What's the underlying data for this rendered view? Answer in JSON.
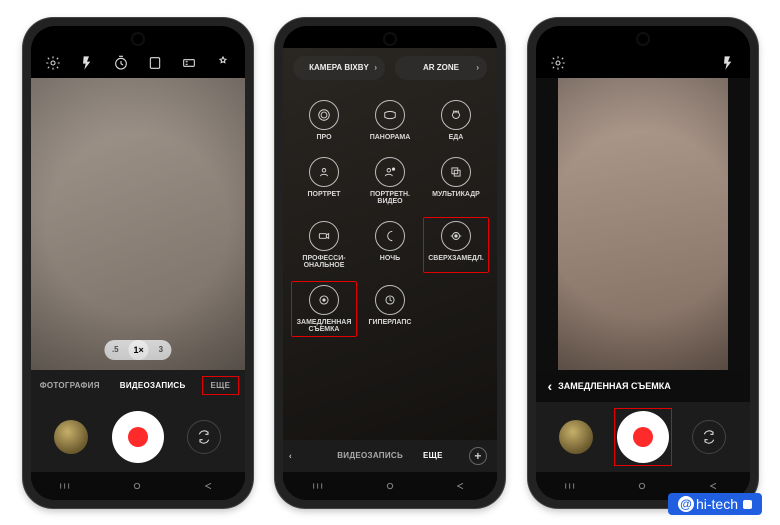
{
  "phone1": {
    "top_icons": [
      "settings",
      "flash",
      "timer",
      "ratio",
      "resolution",
      "filters"
    ],
    "zoom": {
      "levels": [
        ".5",
        "1×",
        "3"
      ],
      "active_index": 1
    },
    "modes": [
      {
        "label": "ФОТОГРАФИЯ",
        "active": false,
        "highlight": false
      },
      {
        "label": "ВИДЕОЗАПИСЬ",
        "active": true,
        "highlight": false
      },
      {
        "label": "ЕЩЕ",
        "active": false,
        "highlight": true
      }
    ],
    "shutter": {
      "type": "video"
    }
  },
  "phone2": {
    "top_pills": [
      {
        "label": "КАМЕРА BIXBY"
      },
      {
        "label": "AR ZONE"
      }
    ],
    "grid": [
      {
        "icon": "pro",
        "label": "ПРО"
      },
      {
        "icon": "panorama",
        "label": "ПАНОРАМА"
      },
      {
        "icon": "food",
        "label": "ЕДА"
      },
      {
        "icon": "portrait",
        "label": "ПОРТРЕТ"
      },
      {
        "icon": "portrait-v",
        "label": "ПОРТРЕТН. ВИДЕО"
      },
      {
        "icon": "multi",
        "label": "МУЛЬТИКАДР"
      },
      {
        "icon": "prof",
        "label": "ПРОФЕССИ-\nОНАЛЬНОЕ"
      },
      {
        "icon": "night",
        "label": "НОЧЬ"
      },
      {
        "icon": "superslow",
        "label": "СВЕРХЗАМЕДЛ.",
        "highlight": true
      },
      {
        "icon": "slowmo",
        "label": "ЗАМЕДЛЕННАЯ СЪЕМКА",
        "highlight": true
      },
      {
        "icon": "hyperlapse",
        "label": "ГИПЕРЛАПС"
      }
    ],
    "modes": {
      "back": "‹",
      "items": [
        {
          "label": "ВИДЕОЗАПИСЬ",
          "active": false
        },
        {
          "label": "ЕЩЕ",
          "active": true
        }
      ],
      "plus": "+"
    }
  },
  "phone3": {
    "top_icons": [
      "settings",
      "flash"
    ],
    "mode_label": "ЗАМЕДЛЕННАЯ СЪЕМКА",
    "mode_back": "‹",
    "shutter": {
      "type": "video",
      "highlight": true
    }
  },
  "watermark": {
    "text": "hi-tech"
  }
}
